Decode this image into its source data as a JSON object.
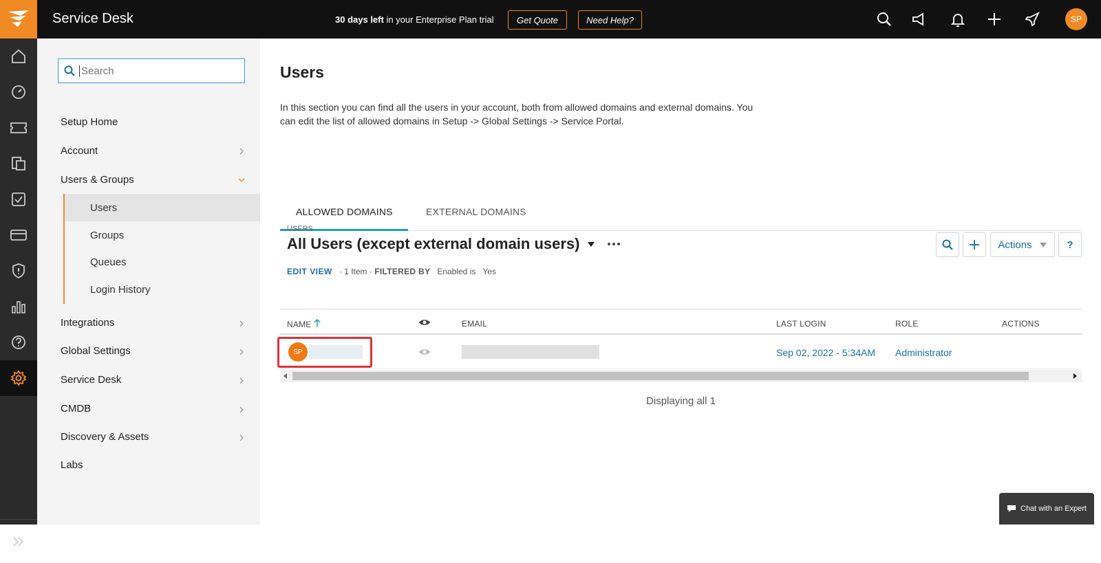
{
  "topbar": {
    "title": "Service Desk",
    "trial_bold": "30 days left",
    "trial_rest": " in your Enterprise Plan trial",
    "get_quote": "Get Quote",
    "need_help": "Need Help?",
    "avatar": "SP"
  },
  "search": {
    "placeholder": "Search"
  },
  "sidebar": {
    "setup_home": "Setup Home",
    "account": "Account",
    "users_groups": "Users & Groups",
    "sub": [
      "Users",
      "Groups",
      "Queues",
      "Login History"
    ],
    "integrations": "Integrations",
    "global_settings": "Global Settings",
    "service_desk": "Service Desk",
    "cmdb": "CMDB",
    "discovery": "Discovery & Assets",
    "labs": "Labs"
  },
  "main": {
    "title": "Users",
    "description": "In this section you can find all the users in your account, both from allowed domains and external domains. You can edit the list of allowed domains in Setup -> Global Settings -> Service Portal.",
    "tabs": [
      "ALLOWED DOMAINS",
      "EXTERNAL DOMAINS"
    ],
    "users_label": "USERS",
    "view_title": "All Users (except external domain users)",
    "edit_view": "EDIT VIEW",
    "item_count": "· 1 Item ·",
    "filtered_by": "FILTERED BY",
    "filter_field": "Enabled is",
    "filter_value": "Yes",
    "actions_label": "Actions",
    "help_label": "?"
  },
  "table": {
    "columns": [
      "NAME",
      "EMAIL",
      "LAST LOGIN",
      "ROLE",
      "ACTIONS"
    ],
    "row": {
      "avatar": "SP",
      "last_login": "Sep 02, 2022 - 5:34AM",
      "role": "Administrator"
    },
    "footer": "Displaying all 1"
  },
  "chat": {
    "label": "Chat with an Expert"
  },
  "colors": {
    "accent": "#f08a24",
    "link": "#1a6fa0",
    "tab": "#1aa1b8",
    "highlight": "#e0313b"
  }
}
